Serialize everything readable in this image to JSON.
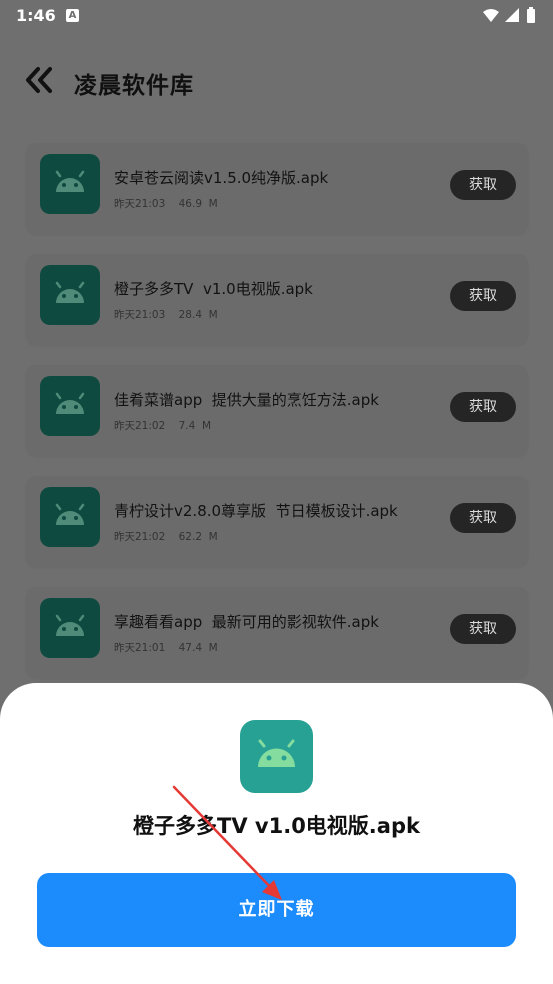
{
  "status_bar": {
    "time": "1:46",
    "notification_icon": "A"
  },
  "header": {
    "title": "凌晨软件库",
    "back_icon": "double-chevron-left-icon"
  },
  "apps": [
    {
      "name": "安卓苍云阅读v1.5.0纯净版.apk",
      "time": "昨天21:03",
      "size": "46.9  M",
      "button": "获取"
    },
    {
      "name": "橙子多多TV  v1.0电视版.apk",
      "time": "昨天21:03",
      "size": "28.4  M",
      "button": "获取"
    },
    {
      "name": "佳肴菜谱app  提供大量的烹饪方法.apk",
      "time": "昨天21:02",
      "size": "7.4  M",
      "button": "获取"
    },
    {
      "name": "青柠设计v2.8.0尊享版  节日模板设计.apk",
      "time": "昨天21:02",
      "size": "62.2  M",
      "button": "获取"
    },
    {
      "name": "享趣看看app  最新可用的影视软件.apk",
      "time": "昨天21:01",
      "size": "47.4  M",
      "button": "获取"
    }
  ],
  "sheet": {
    "filename": "橙子多多TV v1.0电视版.apk",
    "download_label": "立即下载"
  },
  "colors": {
    "overlay_bg": "#6f6f6f",
    "icon_dim": "#0f4a40",
    "icon_bright": "#27a193",
    "download_blue": "#1c8bfc",
    "arrow_red": "#e53935"
  }
}
